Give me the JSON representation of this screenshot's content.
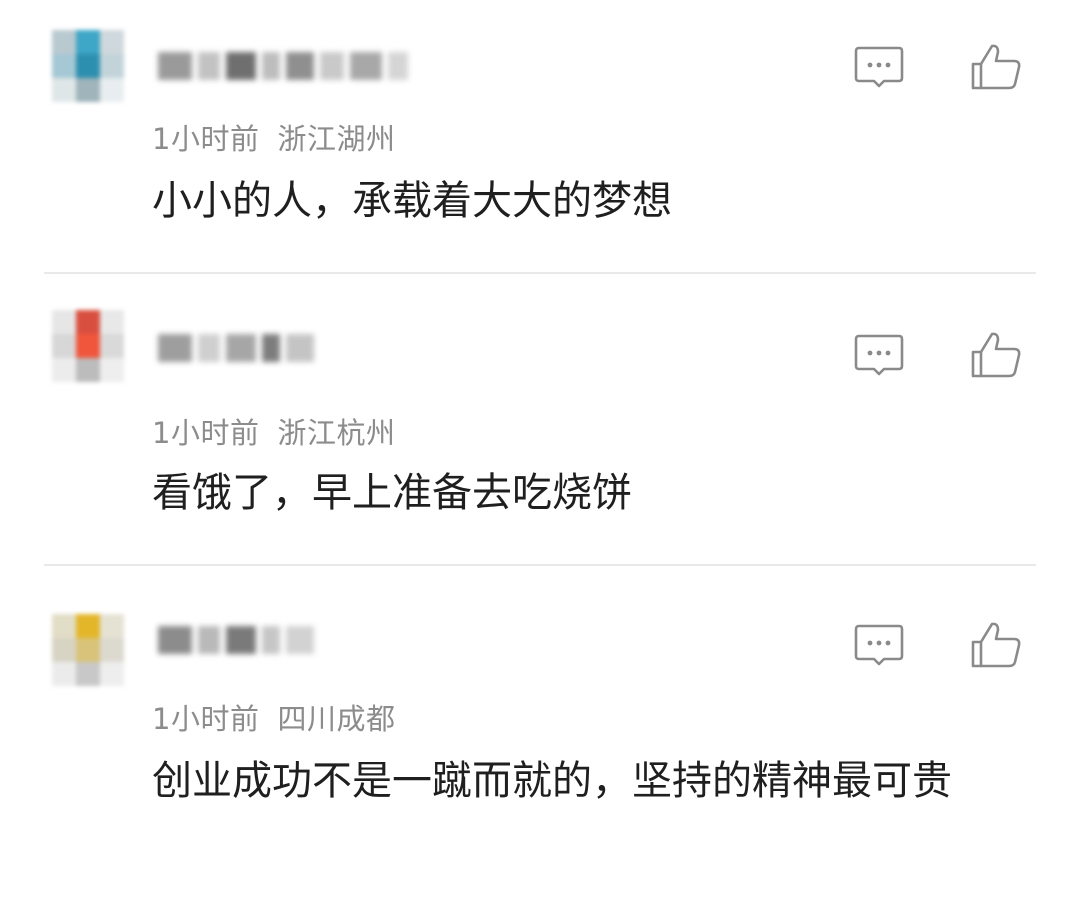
{
  "comments": [
    {
      "time": "1小时前",
      "location": "浙江湖州",
      "text": "小小的人，承载着大大的梦想",
      "avatar_colors": [
        "#b8c9cf",
        "#3ea6c6",
        "#cfd8dc",
        "#a5c8d4",
        "#2d8fb0",
        "#c2d4da",
        "#dfe6e8",
        "#9fb4bb",
        "#e8eef0"
      ],
      "nickname_colors": [
        "#9a9a9a",
        "#c2c2c2",
        "#6f6f6f",
        "#bdbdbd",
        "#8f8f8f",
        "#c9c9c9",
        "#a8a8a8",
        "#d5d5d5"
      ]
    },
    {
      "time": "1小时前",
      "location": "浙江杭州",
      "text": "看饿了，早上准备去吃烧饼",
      "avatar_colors": [
        "#e6e6e6",
        "#d94f3f",
        "#e8e8e8",
        "#d7d7d7",
        "#f0563c",
        "#d9d9d9",
        "#ececec",
        "#bcbcbc",
        "#eeeeee"
      ],
      "nickname_colors": [
        "#9e9e9e",
        "#cfcfcf",
        "#a6a6a6",
        "#7d7d7d",
        "#c4c4c4"
      ]
    },
    {
      "time": "1小时前",
      "location": "四川成都",
      "text": "创业成功不是一蹴而就的，坚持的精神最可贵",
      "avatar_colors": [
        "#e2ddc6",
        "#e3b62a",
        "#e5e2d4",
        "#d8d4c4",
        "#d9c37a",
        "#dcd9cf",
        "#ebebeb",
        "#c8c8c8",
        "#eeeeee"
      ],
      "nickname_colors": [
        "#8c8c8c",
        "#b9b9b9",
        "#7a7a7a",
        "#c6c6c6",
        "#d2d2d2"
      ]
    }
  ],
  "icons": {
    "reply": "comment-bubble-icon",
    "like": "thumbs-up-icon",
    "icon_color": "#8a8a8a",
    "divider_color": "#e9e9e9"
  }
}
